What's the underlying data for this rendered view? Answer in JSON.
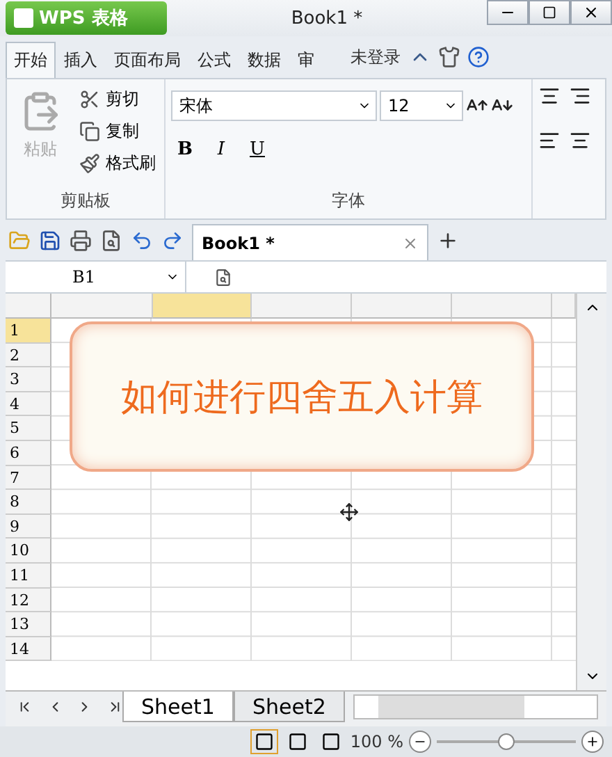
{
  "app_button": {
    "label": "WPS 表格"
  },
  "window": {
    "title": "Book1 *"
  },
  "ribbon_tabs": [
    {
      "label": "开始",
      "selected": true
    },
    {
      "label": "插入",
      "selected": false
    },
    {
      "label": "页面布局",
      "selected": false
    },
    {
      "label": "公式",
      "selected": false
    },
    {
      "label": "数据",
      "selected": false
    },
    {
      "label": "审",
      "selected": false
    }
  ],
  "account": "未登录",
  "clipboard": {
    "paste": {
      "label": "粘贴",
      "disabled": true
    },
    "items": [
      {
        "kind": "cut",
        "label": "剪切"
      },
      {
        "kind": "copy",
        "label": "复制"
      },
      {
        "kind": "brush",
        "label": "格式刷"
      }
    ],
    "group_label": "剪贴板"
  },
  "font": {
    "family": "宋体",
    "size": "12",
    "styles": [
      "B",
      "I",
      "U"
    ],
    "group_label": "字体"
  },
  "document_tab": {
    "title": "Book1 *"
  },
  "formula_bar": {
    "name_box": "B1"
  },
  "grid": {
    "columns": [
      {
        "selected": false
      },
      {
        "selected": true
      },
      {
        "selected": false
      },
      {
        "selected": false
      },
      {
        "selected": false
      },
      {
        "selected": false
      }
    ],
    "rows": [
      {
        "label": "1",
        "selected": true
      },
      {
        "label": "2",
        "selected": false
      },
      {
        "label": "3",
        "selected": false
      },
      {
        "label": "4",
        "selected": false
      },
      {
        "label": "5",
        "selected": false
      },
      {
        "label": "6",
        "selected": false
      },
      {
        "label": "7",
        "selected": false
      },
      {
        "label": "8",
        "selected": false
      },
      {
        "label": "9",
        "selected": false
      },
      {
        "label": "10",
        "selected": false
      },
      {
        "label": "11",
        "selected": false
      },
      {
        "label": "12",
        "selected": false
      },
      {
        "label": "13",
        "selected": false
      },
      {
        "label": "14",
        "selected": false
      }
    ]
  },
  "overlay_card": {
    "text": "如何进行四舍五入计算"
  },
  "sheets": [
    {
      "label": "Sheet1",
      "selected": true
    },
    {
      "label": "Sheet2",
      "selected": false
    }
  ],
  "status_bar": {
    "zoom": "100 %",
    "zoom_level": {
      "level": 0.5
    }
  }
}
